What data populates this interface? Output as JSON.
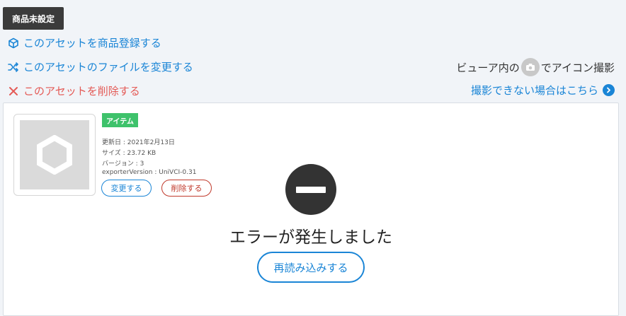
{
  "status_tag": "商品未設定",
  "actions": {
    "register": "このアセットを商品登録する",
    "change_file": "このアセットのファイルを変更する",
    "delete": "このアセットを削除する"
  },
  "viewer_hint": {
    "before": "ビューア内の",
    "after": "でアイコン撮影"
  },
  "help_link": "撮影できない場合はこちら",
  "asset": {
    "type_badge": "アイテム",
    "updated": "更新日 : 2021年2月13日",
    "size": "サイズ : 23.72 KB",
    "version": "バージョン : 3",
    "exporter": "exporterVersion : UniVCI-0.31",
    "change_button": "変更する",
    "delete_button": "削除する"
  },
  "error": {
    "message": "エラーが発生しました",
    "reload_button": "再読み込みする"
  },
  "colors": {
    "accent": "#1a85d6",
    "danger": "#e45a56",
    "badge_green": "#3ec26b"
  }
}
